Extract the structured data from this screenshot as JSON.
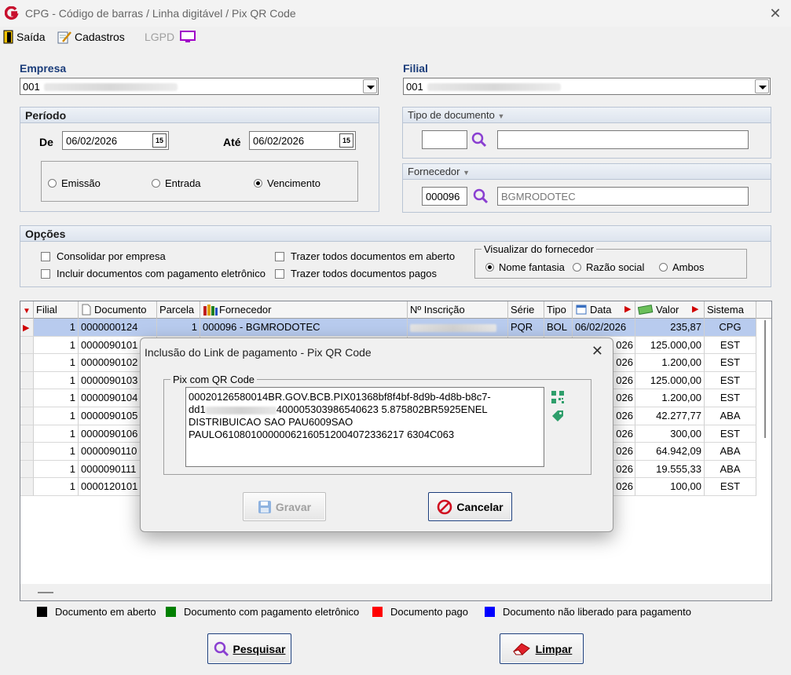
{
  "window": {
    "title": "CPG - Código de barras / Linha digitável / Pix QR Code"
  },
  "toolbar": {
    "exit": "Saída",
    "registers": "Cadastros",
    "lgpd": "LGPD"
  },
  "empresa": {
    "label": "Empresa",
    "value": "001"
  },
  "filial": {
    "label": "Filial",
    "value": "001"
  },
  "periodo": {
    "label": "Período",
    "de_label": "De",
    "de_value": "06/02/2026",
    "ate_label": "Até",
    "ate_value": "06/02/2026",
    "cal_icon_text": "15",
    "radios": [
      "Emissão",
      "Entrada",
      "Vencimento"
    ],
    "selected": "Vencimento"
  },
  "tipo_documento": {
    "label": "Tipo de documento",
    "code": "",
    "desc": ""
  },
  "fornecedor": {
    "label": "Fornecedor",
    "code": "000096",
    "desc": "BGMRODOTEC"
  },
  "opcoes": {
    "label": "Opções",
    "checks": [
      "Consolidar por empresa",
      "Incluir documentos com pagamento eletrônico",
      "Trazer todos documentos em aberto",
      "Trazer todos documentos pagos"
    ],
    "visualizar": {
      "label": "Visualizar do fornecedor",
      "options": [
        "Nome fantasia",
        "Razão social",
        "Ambos"
      ],
      "selected": "Nome fantasia"
    }
  },
  "grid": {
    "headers": [
      "Filial",
      "Documento",
      "Parcela",
      "Fornecedor",
      "Nº Inscrição",
      "Série",
      "Tipo",
      "Data",
      "Valor",
      "Sistema"
    ],
    "rows": [
      {
        "filial": "1",
        "documento": "0000000124",
        "parcela": "1",
        "fornecedor": "000096 - BGMRODOTEC",
        "serie": "PQR",
        "tipo": "BOL",
        "data": "06/02/2026",
        "valor": "235,87",
        "sistema": "CPG"
      },
      {
        "filial": "1",
        "documento": "0000090101",
        "data": "026",
        "valor": "125.000,00",
        "sistema": "EST"
      },
      {
        "filial": "1",
        "documento": "0000090102",
        "data": "026",
        "valor": "1.200,00",
        "sistema": "EST"
      },
      {
        "filial": "1",
        "documento": "0000090103",
        "data": "026",
        "valor": "125.000,00",
        "sistema": "EST"
      },
      {
        "filial": "1",
        "documento": "0000090104",
        "data": "026",
        "valor": "1.200,00",
        "sistema": "EST"
      },
      {
        "filial": "1",
        "documento": "0000090105",
        "data": "026",
        "valor": "42.277,77",
        "sistema": "ABA"
      },
      {
        "filial": "1",
        "documento": "0000090106",
        "data": "026",
        "valor": "300,00",
        "sistema": "EST"
      },
      {
        "filial": "1",
        "documento": "0000090110",
        "data": "026",
        "valor": "64.942,09",
        "sistema": "ABA"
      },
      {
        "filial": "1",
        "documento": "0000090111",
        "data": "026",
        "valor": "19.555,33",
        "sistema": "ABA"
      },
      {
        "filial": "1",
        "documento": "0000120101",
        "data": "026",
        "valor": "100,00",
        "sistema": "EST"
      }
    ]
  },
  "legend": [
    {
      "label": "Documento em aberto",
      "color": "#000000"
    },
    {
      "label": "Documento com pagamento eletrônico",
      "color": "#008000"
    },
    {
      "label": "Documento pago",
      "color": "#ff0000"
    },
    {
      "label": "Documento não liberado para pagamento",
      "color": "#0000ff"
    }
  ],
  "buttons": {
    "search": "Pesquisar",
    "clear": "Limpar"
  },
  "modal": {
    "title": "Inclusão do Link de pagamento - Pix QR Code",
    "group_label": "Pix com QR Code",
    "pix_lines": [
      "00020126580014BR.GOV.BCB.PIX01368bf8f4bf-8d9b-4d8b-b8c7-",
      "dd1",
      "400005303986540623 5.875802BR5925ENEL",
      "DISTRIBUICAO SAO PAU6009SAO",
      "PAULO61080100000062160512004072336217 6304C063"
    ],
    "save": "Gravar",
    "cancel": "Cancelar"
  },
  "colors": {
    "accent": "#1a3c7a",
    "selected_row": "#b8cbee",
    "qr_icon": "#2e9e6b"
  }
}
